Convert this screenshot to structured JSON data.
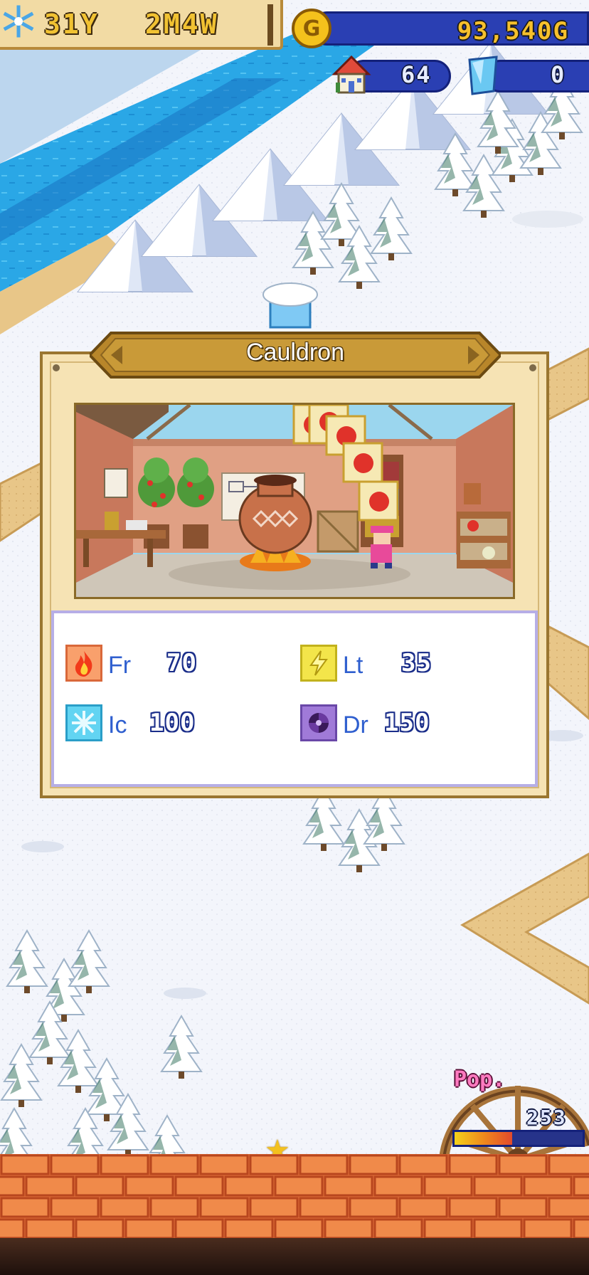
{
  "hud": {
    "date_year": "31Y",
    "date_month_week": "2M4W",
    "season_icon": "snowflake-icon",
    "gold": "93,540G",
    "houses": "64",
    "crystals": "0"
  },
  "panel": {
    "title": "Cauldron",
    "stats": [
      {
        "icon": "fire-icon",
        "label": "Fr",
        "value": "70",
        "color": "#f4a06a"
      },
      {
        "icon": "lightning-icon",
        "label": "Lt",
        "value": "35",
        "color": "#f2e44a"
      },
      {
        "icon": "ice-icon",
        "label": "Ic",
        "value": "100",
        "color": "#6ad7f4"
      },
      {
        "icon": "dark-icon",
        "label": "Dr",
        "value": "150",
        "color": "#9a78d8"
      }
    ]
  },
  "population": {
    "label": "Pop.",
    "value": "253",
    "fill_fraction": 0.45
  }
}
